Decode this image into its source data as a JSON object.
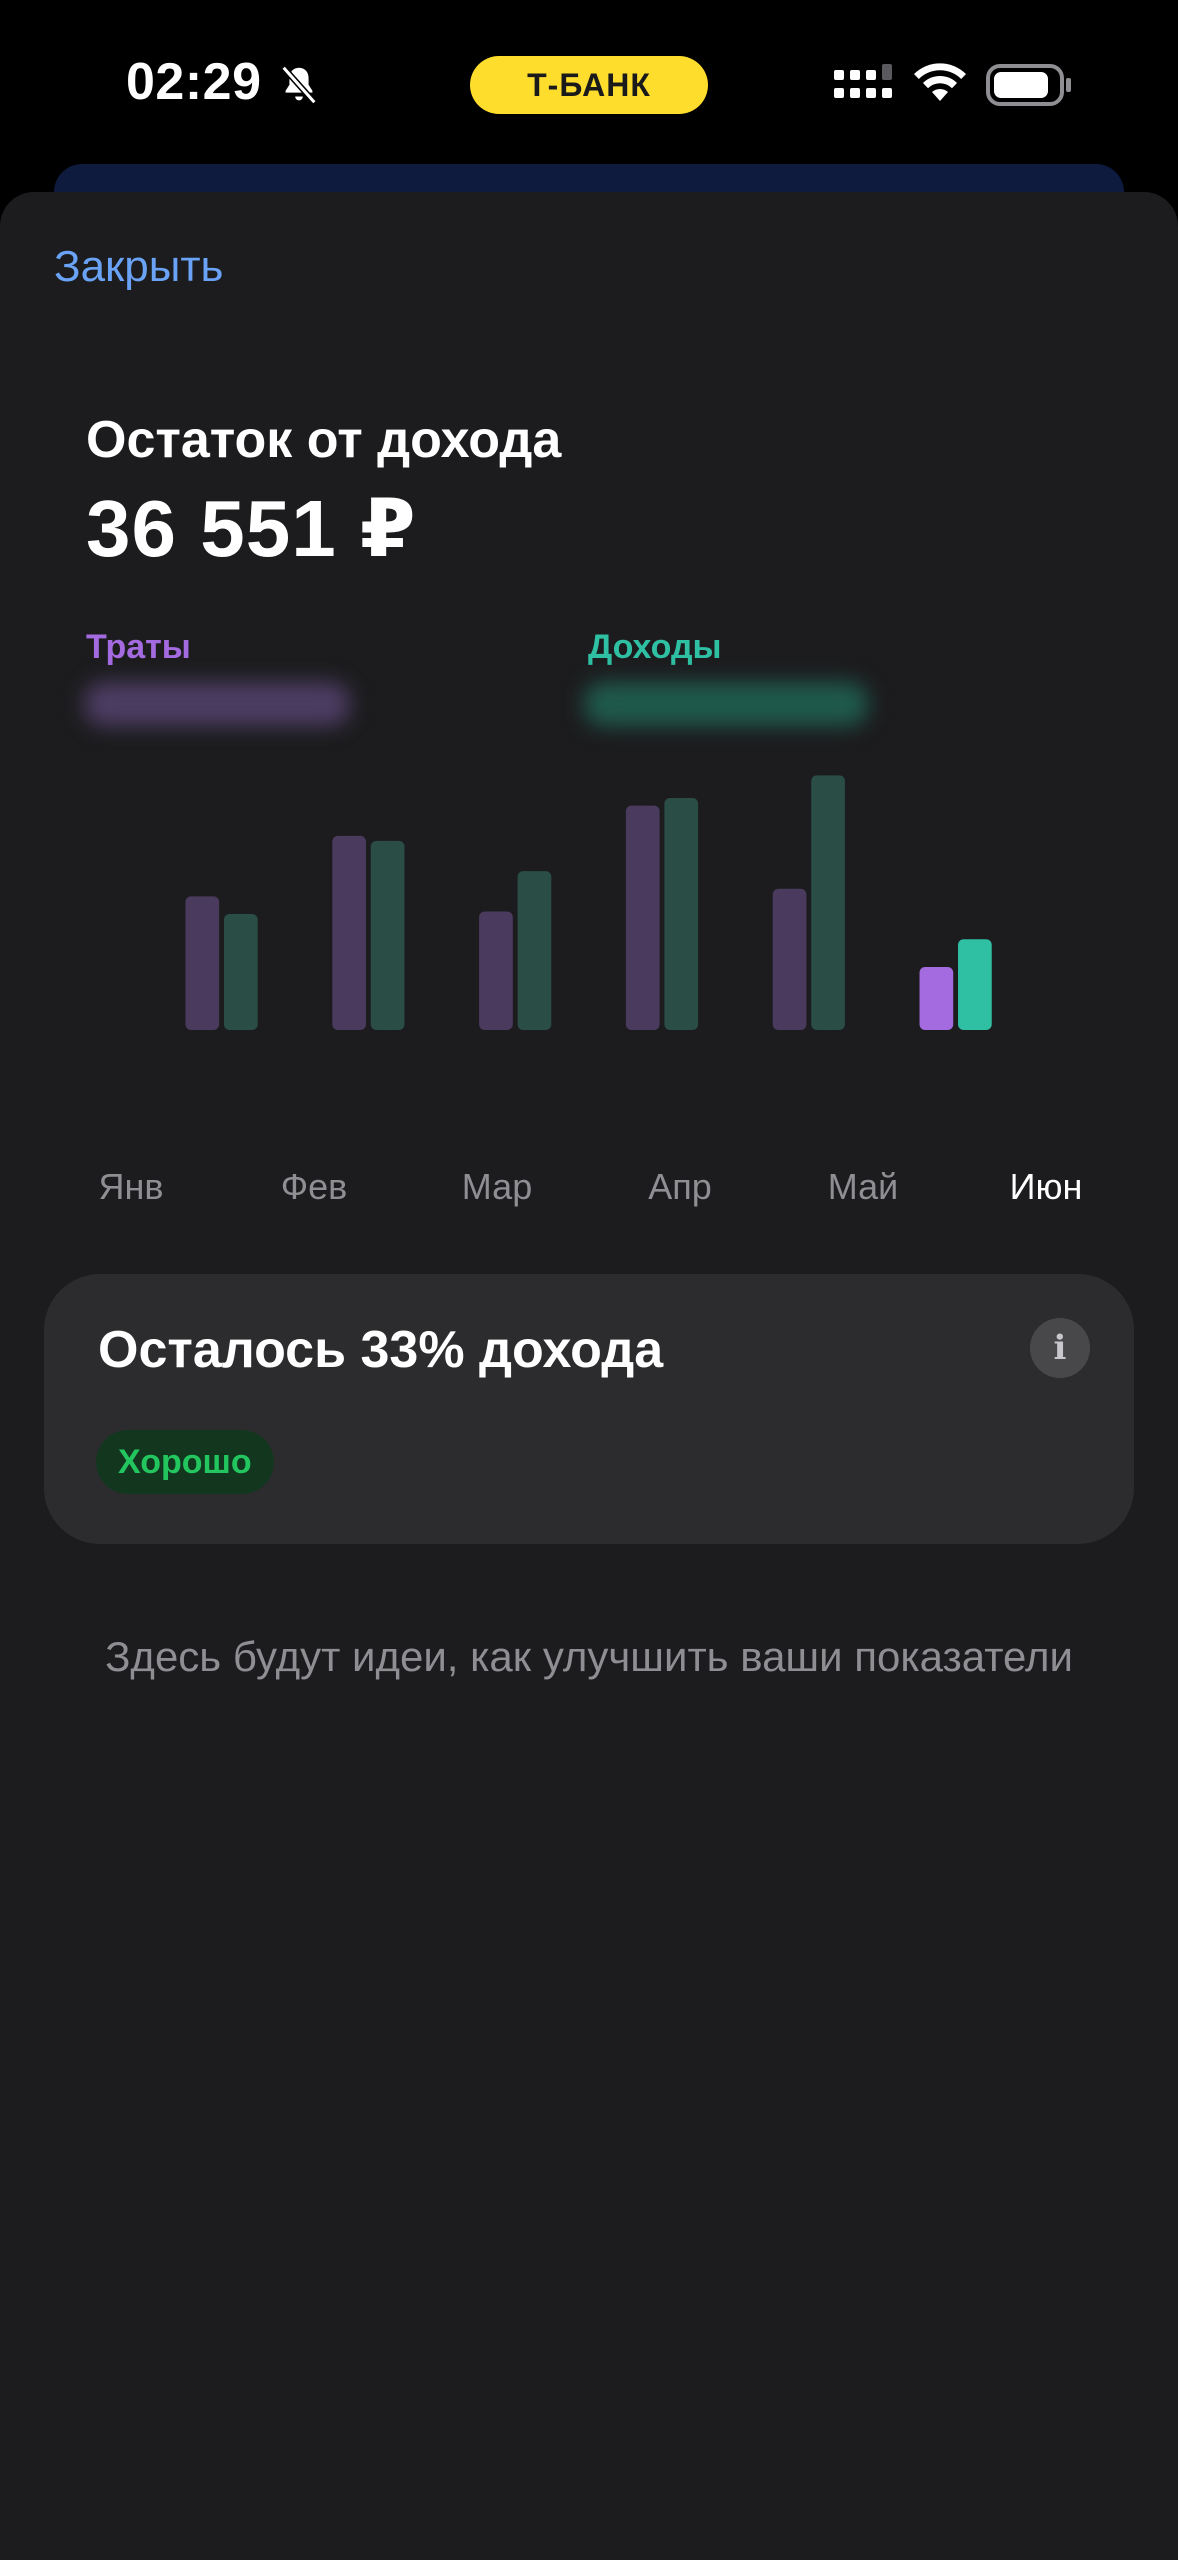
{
  "status_bar": {
    "time": "02:29",
    "brand": "Т-БАНК",
    "icons": [
      "bell-slash-icon",
      "cellular-signal-icon",
      "wifi-icon",
      "battery-icon"
    ]
  },
  "sheet": {
    "close_label": "Закрыть",
    "title": "Остаток от дохода",
    "amount": "36 551 ₽",
    "legend": {
      "spend_label": "Траты",
      "income_label": "Доходы"
    }
  },
  "colors": {
    "accent_blue": "#6aa3f5",
    "brand_yellow": "#ffdd2d",
    "spend": "#a46ae0",
    "income": "#2fbfa2",
    "spend_dim": "#4a3a5e",
    "income_dim": "#2a4d45",
    "good": "#22c55e"
  },
  "chart_data": {
    "type": "bar",
    "categories": [
      "Янв",
      "Фев",
      "Мар",
      "Апр",
      "Май",
      "Июн"
    ],
    "series": [
      {
        "name": "Траты",
        "values": [
          53,
          77,
          47,
          89,
          56,
          25
        ]
      },
      {
        "name": "Доходы",
        "values": [
          46,
          75,
          63,
          92,
          101,
          36
        ]
      }
    ],
    "active_category": "Июн",
    "ylim": [
      0,
      105
    ],
    "grid": false
  },
  "summary_card": {
    "title": "Осталось 33% дохода",
    "badge": "Хорошо",
    "info_icon": "info-icon"
  },
  "hint": "Здесь будут идеи, как улучшить ваши показатели"
}
